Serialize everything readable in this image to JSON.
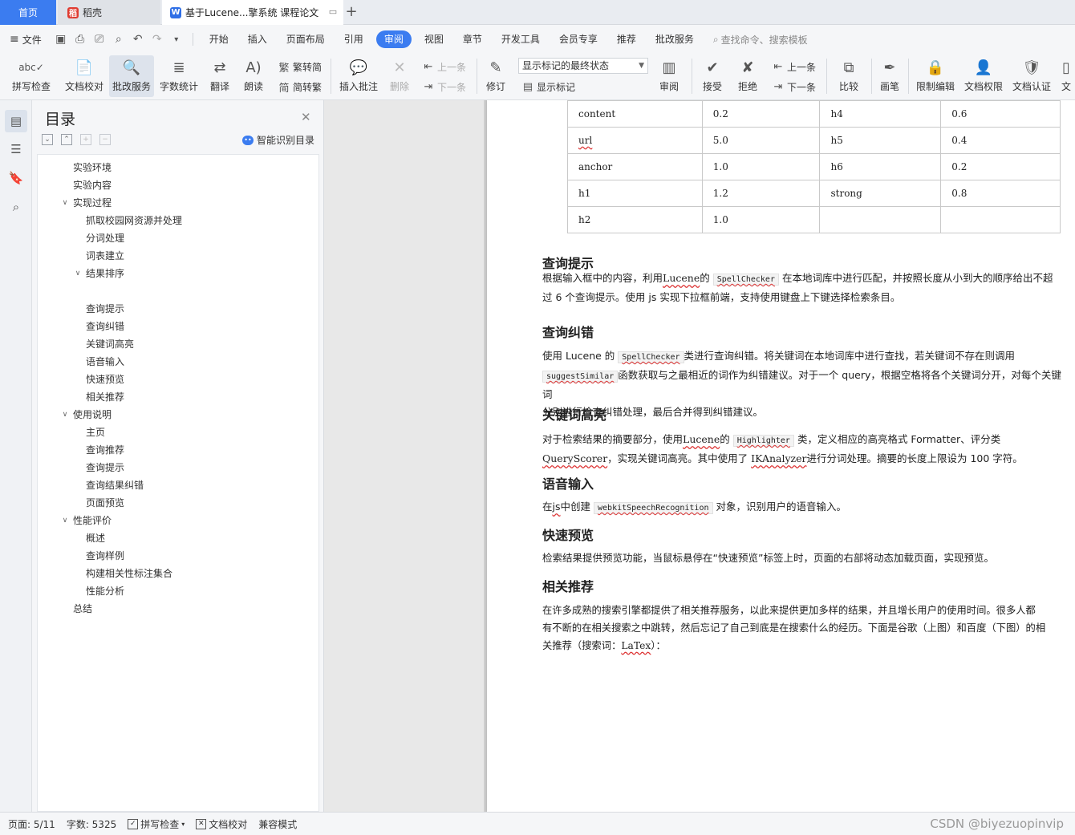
{
  "tabs": {
    "home": "首页",
    "daoke": "稻壳",
    "doc": "基于Lucene...擎系统 课程论文"
  },
  "menu": {
    "file": "文件",
    "tabs": [
      "开始",
      "插入",
      "页面布局",
      "引用",
      "审阅",
      "视图",
      "章节",
      "开发工具",
      "会员专享",
      "推荐",
      "批改服务"
    ],
    "active_tab": "审阅",
    "search": "查找命令、搜索模板"
  },
  "ribbon": {
    "spell_check": "拼写检查",
    "doc_proofread": "文档校对",
    "correction_service": "批改服务",
    "word_count": "字数统计",
    "translate": "翻译",
    "read_aloud": "朗读",
    "to_traditional": "繁转简",
    "to_simplified": "简转繁",
    "insert_comment": "插入批注",
    "delete": "删除",
    "prev_comment": "上一条",
    "next_comment": "下一条",
    "revise": "修订",
    "markup_select": "显示标记的最终状态",
    "show_markup": "显示标记",
    "review": "审阅",
    "accept": "接受",
    "reject": "拒绝",
    "prev_change": "上一条",
    "next_change": "下一条",
    "compare": "比较",
    "ink": "画笔",
    "restrict_edit": "限制编辑",
    "doc_permission": "文档权限",
    "doc_certify": "文档认证",
    "more": "文"
  },
  "toc": {
    "title": "目录",
    "smart": "智能识别目录",
    "items": [
      {
        "label": "实验环境",
        "level": 1,
        "arrow": ""
      },
      {
        "label": "实验内容",
        "level": 1,
        "arrow": ""
      },
      {
        "label": "实现过程",
        "level": 1,
        "arrow": "v"
      },
      {
        "label": "抓取校园网资源并处理",
        "level": 2,
        "arrow": ""
      },
      {
        "label": "分词处理",
        "level": 2,
        "arrow": ""
      },
      {
        "label": "词表建立",
        "level": 2,
        "arrow": ""
      },
      {
        "label": "结果排序",
        "level": 2,
        "arrow": "v"
      },
      {
        "label": "",
        "level": 2,
        "arrow": ""
      },
      {
        "label": "查询提示",
        "level": 2,
        "arrow": ""
      },
      {
        "label": "查询纠错",
        "level": 2,
        "arrow": ""
      },
      {
        "label": "关键词高亮",
        "level": 2,
        "arrow": ""
      },
      {
        "label": "语音输入",
        "level": 2,
        "arrow": ""
      },
      {
        "label": "快速预览",
        "level": 2,
        "arrow": ""
      },
      {
        "label": "相关推荐",
        "level": 2,
        "arrow": ""
      },
      {
        "label": "使用说明",
        "level": 1,
        "arrow": "v"
      },
      {
        "label": "主页",
        "level": 2,
        "arrow": ""
      },
      {
        "label": "查询推荐",
        "level": 2,
        "arrow": ""
      },
      {
        "label": "查询提示",
        "level": 2,
        "arrow": ""
      },
      {
        "label": "查询结果纠错",
        "level": 2,
        "arrow": ""
      },
      {
        "label": "页面预览",
        "level": 2,
        "arrow": ""
      },
      {
        "label": "性能评价",
        "level": 1,
        "arrow": "v"
      },
      {
        "label": "概述",
        "level": 2,
        "arrow": ""
      },
      {
        "label": "查询样例",
        "level": 2,
        "arrow": ""
      },
      {
        "label": "构建相关性标注集合",
        "level": 2,
        "arrow": ""
      },
      {
        "label": "性能分析",
        "level": 2,
        "arrow": ""
      },
      {
        "label": "总结",
        "level": 1,
        "arrow": ""
      }
    ]
  },
  "table": [
    [
      "content",
      "0.2",
      "h4",
      "0.6"
    ],
    [
      "url",
      "5.0",
      "h5",
      "0.4"
    ],
    [
      "anchor",
      "1.0",
      "h6",
      "0.2"
    ],
    [
      "h1",
      "1.2",
      "strong",
      "0.8"
    ],
    [
      "h2",
      "1.0",
      "",
      ""
    ]
  ],
  "sections": {
    "s1_title": "查询提示",
    "s1_a": "根据输入框中的内容，利用",
    "s1_lucene": "Lucene",
    "s1_b": "的",
    "s1_code": "SpellChecker",
    "s1_c": "在本地词库中进行匹配，并按照长度从小到大的顺序给出不超",
    "s1_d": "过 6 个查询提示。使用 js 实现下拉框前端，支持使用键盘上下键选择检索条目。",
    "s2_title": "查询纠错",
    "s2_a": "使用 Lucene 的",
    "s2_code1": "SpellChecker",
    "s2_b": "类进行查询纠错。将关键词在本地词库中进行查找，若关键词不存在则调用",
    "s2_code2": "suggestSimilar",
    "s2_c": "函数获取与之最相近的词作为纠错建议。对于一个 query，根据空格将各个关键词分开，对每个关键词",
    "s2_d": "分别进行检查纠错处理，最后合并得到纠错建议。",
    "s3_title": "关键词高亮",
    "s3_a": "对于检索结果的摘要部分，使用",
    "s3_lucene": "Lucene",
    "s3_b": "的",
    "s3_code": "Highlighter",
    "s3_c": "类，定义相应的高亮格式 Formatter、评分类",
    "s3_qs": "QueryScorer",
    "s3_d": "，实现关键词高亮。其中使用了",
    "s3_ik": "IKAnalyzer",
    "s3_e": "进行分词处理。摘要的长度上限设为 100 字符。",
    "s4_title": "语音输入",
    "s4_a": "在",
    "s4_js": "js",
    "s4_b": "中创建",
    "s4_code": "webkitSpeechRecognition",
    "s4_c": "对象，识别用户的语音输入。",
    "s5_title": "快速预览",
    "s5_a": "检索结果提供预览功能，当鼠标悬停在“快速预览”标签上时，页面的右部将动态加载页面，实现预览。",
    "s6_title": "相关推荐",
    "s6_a": "在许多成熟的搜索引擎都提供了相关推荐服务，以此来提供更加多样的结果，并且增长用户的使用时间。很多人都",
    "s6_b": "有不断的在相关搜索之中跳转，然后忘记了自己到底是在搜索什么的经历。下面是谷歌（上图）和百度（下图）的相",
    "s6_c": "关推荐（搜索词：",
    "s6_latex": "LaTex",
    "s6_d": "）："
  },
  "status": {
    "page": "页面: 5/11",
    "words": "字数: 5325",
    "spell": "拼写检查",
    "proof": "文档校对",
    "compat": "兼容模式"
  },
  "watermark": "CSDN @biyezuopinvip",
  "colors": {
    "accent": "#3b7cf0",
    "tab_home": "#3b7cf0",
    "daoke_icon": "#e03c31",
    "wps_icon": "#2f6fe6"
  }
}
